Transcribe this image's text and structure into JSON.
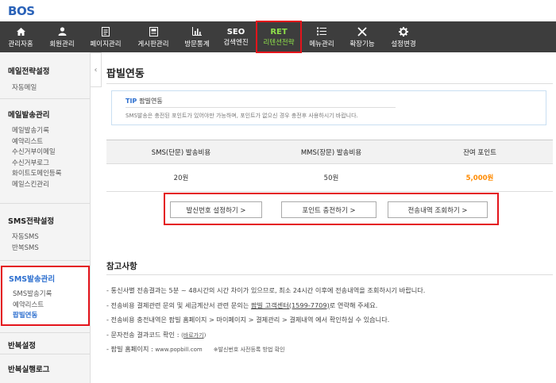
{
  "logo": {
    "text_b": "B",
    "text_o": "O",
    "text_s": "S"
  },
  "nav": {
    "items": [
      {
        "label": "관리자홈",
        "icon": "home-icon"
      },
      {
        "label": "회원관리",
        "icon": "user-icon"
      },
      {
        "label": "페이지관리",
        "icon": "page-icon"
      },
      {
        "label": "게시판관리",
        "icon": "board-icon"
      },
      {
        "label": "방문통계",
        "icon": "chart-icon"
      },
      {
        "label": "검색엔진",
        "top": "SEO"
      },
      {
        "label": "리텐션전략",
        "top": "RET"
      },
      {
        "label": "메뉴관리",
        "icon": "menu-list-icon"
      },
      {
        "label": "확장기능",
        "icon": "tools-icon"
      },
      {
        "label": "설정변경",
        "icon": "gear-icon"
      }
    ]
  },
  "sidebar": {
    "mail_strategy": {
      "head": "메일전략설정",
      "items": [
        "자동메일"
      ]
    },
    "mail_send": {
      "head": "메일발송관리",
      "items": [
        "메일발송기록",
        "예약리스트",
        "수신거부이메일",
        "수신거부로그",
        "화이트도메인등록",
        "메일스킨관리"
      ]
    },
    "sms_strategy": {
      "head": "SMS전략설정",
      "items": [
        "자동SMS",
        "반복SMS"
      ]
    },
    "sms_send": {
      "head": "SMS발송관리",
      "items": [
        "SMS발송기록",
        "예약리스트",
        "팝빌연동"
      ]
    },
    "repeat_setting": "반복설정",
    "repeat_log": "반복실행로그",
    "collapse_glyph": "‹"
  },
  "main": {
    "title": "팝빌연동",
    "tip": {
      "label": "TIP",
      "title": "팝빌연동",
      "body": "SMS발송은 충전된 포인트가 있어야만 가능하며, 포인트가 없으신 경우 충전후 사용하시기 바랍니다."
    },
    "table": {
      "headers": [
        "SMS(단문) 발송비용",
        "MMS(장문) 발송비용",
        "잔여 포인트"
      ],
      "row": [
        "20원",
        "50원",
        "5,000원"
      ]
    },
    "buttons": {
      "sender": "발신번호 설정하기 >",
      "charge": "포인트 충전하기 >",
      "history": "전송내역 조회하기 >"
    },
    "reference": {
      "title": "참고사항",
      "lines": [
        "- 통신사별 전송결과는 5분 ~ 48시간의 시간 차이가 있으므로, 최소 24시간 이후에 전송내역을 조회하시기 바랍니다.",
        "- 전송비용 결제관련 문의 및 세금계산서 관련 문의는 ",
        "- 전송비용 충전내역은 팝빌 홈페이지 > 마이페이지 > 결제관리 > 결제내역 에서 확인하실 수 있습니다.",
        "- 문자전송 결과코드 확인 : ",
        "- 팝빌 홈페이지 : "
      ],
      "line2_link": "팝빌 고객센터(1599-7709)",
      "line2_tail": "로 연락해 주세요.",
      "line4_link": "바로가기",
      "line4_tail": "",
      "line5_site": "www.popbill.com",
      "line5_note": "※발신번호 사전등록 방법 확인"
    }
  }
}
